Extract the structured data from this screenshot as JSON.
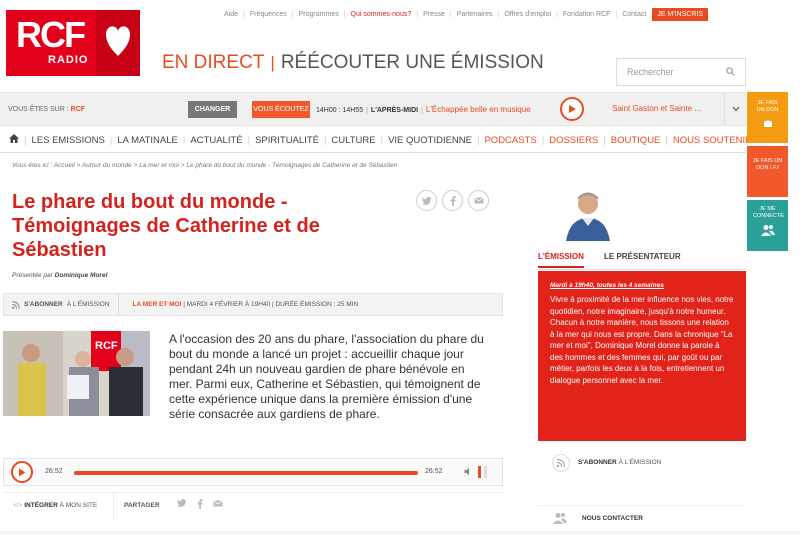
{
  "top_links": [
    "Aide",
    "Fréquences",
    "Programmes",
    "Qui sommes-nous?",
    "Presse",
    "Partenaires",
    "Offres d'emploi",
    "Fondation RCF",
    "Contact"
  ],
  "top_active": "Qui sommes-nous?",
  "inscris_label": "JE M'INSCRIS",
  "logo": {
    "main": "RCF",
    "sub": "RADIO"
  },
  "direct": {
    "live": "EN DIRECT",
    "replay": "RÉÉCOUTER UNE ÉMISSION"
  },
  "search": {
    "placeholder": "Rechercher"
  },
  "station": {
    "label": "VOUS ÊTES SUR :",
    "name": "RCF",
    "change_label": "CHANGER"
  },
  "now_playing": {
    "badge": "VOUS ÉCOUTEZ",
    "time": "14H00 : 14H55",
    "show": "L'APRÈS-MIDI",
    "title": "L'Échappée belle en musique"
  },
  "saint": "Saint Gaston et Sainte ...",
  "nav": [
    "LES EMISSIONS",
    "LA MATINALE",
    "ACTUALITÉ",
    "SPIRITUALITÉ",
    "CULTURE",
    "VIE QUOTIDIENNE",
    "PODCASTS",
    "DOSSIERS",
    "BOUTIQUE",
    "NOUS SOUTENIR"
  ],
  "breadcrumb": "Vous êtes ici : Accueil > Autour du monde > La mer et moi > Le phare du bout du monde - Témoignages de Catherine et de Sébastien",
  "side_buttons": {
    "don": "JE FAIS UN DON",
    "ifi": "JE FAIS UN DON I.F.I",
    "connect": "JE ME CONNECTE"
  },
  "article": {
    "title": "Le phare du bout du monde - Témoignages de Catherine et de Sébastien",
    "presenter_prefix": "Présentée par",
    "presenter": "Dominique Morel",
    "subscribe": "S'ABONNER",
    "subscribe_suffix": "À L'ÉMISSION",
    "category": "LA MER ET MOI",
    "date": "MARDI 4 FÉVRIER À 19H40",
    "duration": "DURÉE ÉMISSION : 25 MIN",
    "body": "A l'occasion des 20 ans du phare, l'association du phare du bout du monde a lancé un projet : accueillir chaque jour pendant 24h un nouveau gardien de phare bénévole en mer. Parmi eux, Catherine et Sébastien, qui témoignent de cette expérience unique dans la première émission d'une série consacrée aux gardiens de phare."
  },
  "player": {
    "current": "26:52",
    "total": "26:52",
    "progress": 1.0
  },
  "integrate": {
    "label": "INTÉGRER",
    "suffix": "À MON SITE",
    "share": "PARTAGER"
  },
  "right_column": {
    "tab_emission": "L'ÉMISSION",
    "tab_presenter": "LE PRÉSENTATEUR",
    "schedule": "Mardi à 19h40, toutes les 4 semaines",
    "description": "Vivre à proximité de la mer influence nos vies, notre quotidien, notre imaginaire, jusqu'à notre humeur. Chacun à notre manière, nous tissons une relation à la mer qui nous est propre. Dans la chronique \"La mer et moi\", Dominique Morel donne la parole à des hommes et des femmes qui, par goût ou par métier, parfois les deux à la fois, entretiennent un dialogue personnel avec la mer.",
    "subscribe": "S'ABONNER",
    "subscribe_suffix": "À L'ÉMISSION",
    "contact": "NOUS CONTACTER"
  },
  "colors": {
    "brand_red": "#e2001a",
    "accent_orange": "#e94b20"
  }
}
